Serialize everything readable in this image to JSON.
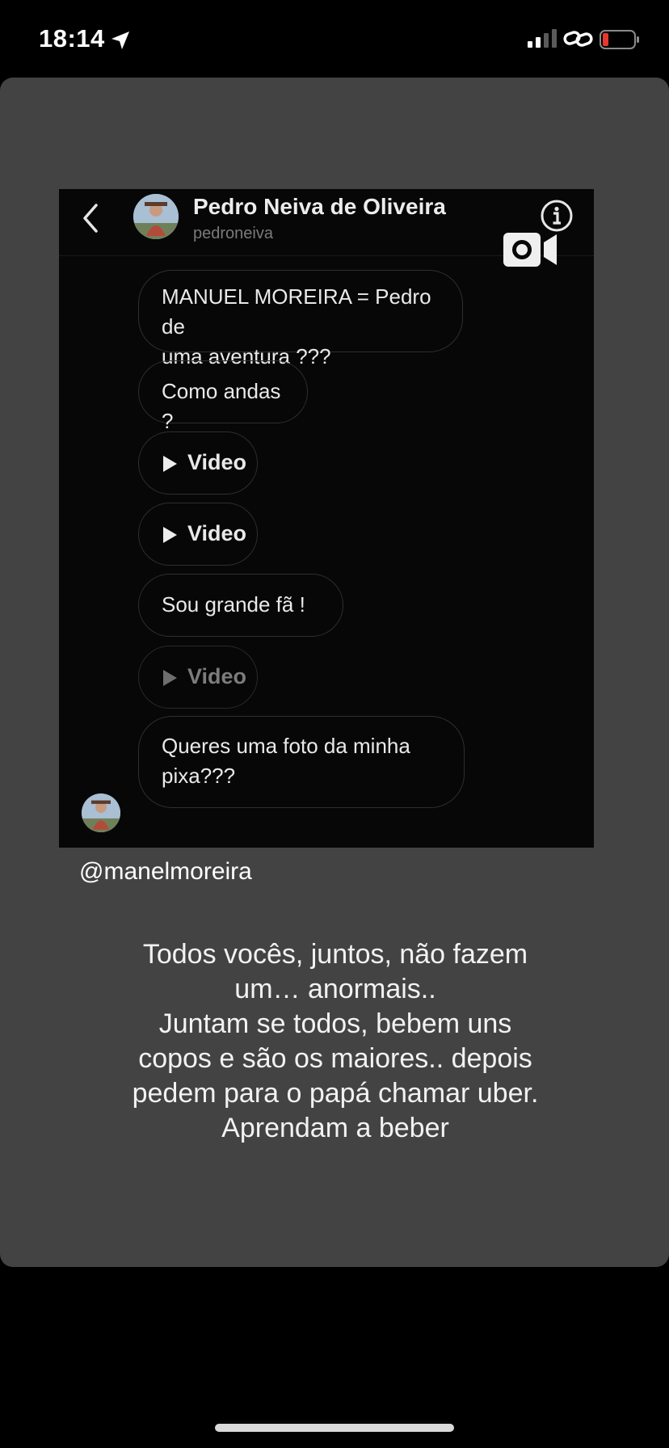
{
  "status_bar": {
    "time": "18:14",
    "icons": [
      "location-arrow-icon",
      "cell-signal-icon",
      "link-icon",
      "battery-low-icon"
    ],
    "battery_color": "#e5382f"
  },
  "dm": {
    "contact_name": "Pedro Neiva de Oliveira",
    "contact_username": "pedroneiva",
    "messages": [
      {
        "type": "text",
        "lines": [
          "MANUEL MOREIRA = Pedro de",
          "uma aventura ???"
        ]
      },
      {
        "type": "text",
        "lines": [
          "Como andas ?"
        ]
      },
      {
        "type": "video",
        "label": "Video"
      },
      {
        "type": "video",
        "label": "Video"
      },
      {
        "type": "text",
        "lines": [
          "Sou grande fã !"
        ]
      },
      {
        "type": "video",
        "label": "Video"
      },
      {
        "type": "text",
        "lines": [
          "Queres uma foto da minha",
          "pixa???"
        ]
      }
    ]
  },
  "story": {
    "handle": "@manelmoreira",
    "caption_lines": [
      "Todos vocês, juntos, não fazem",
      "um… anormais..",
      "Juntam se todos, bebem uns",
      "copos e são os maiores.. depois",
      "pedem para o papá chamar uber.",
      "Aprendam a beber"
    ]
  },
  "colors": {
    "card_background": "#434343",
    "screen_background": "#000000",
    "dm_background": "#070707"
  }
}
